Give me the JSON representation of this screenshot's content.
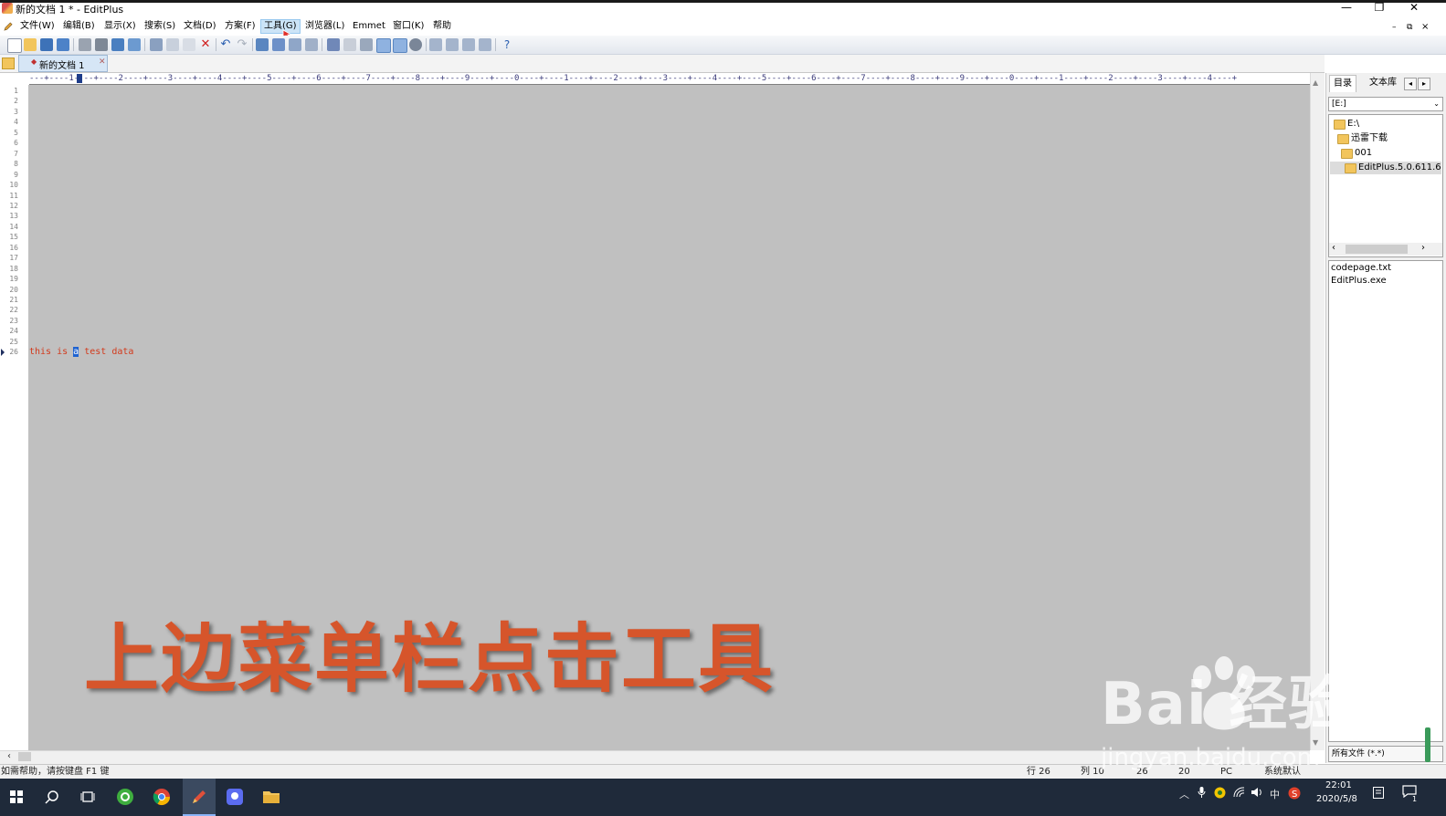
{
  "window": {
    "title": "新的文档 1 * - EditPlus",
    "minimize": "—",
    "restore": "❐",
    "close": "✕",
    "doc_min": "–",
    "doc_restore": "⧉",
    "doc_close": "×"
  },
  "menu": {
    "items": [
      {
        "label": "文件(W)"
      },
      {
        "label": "编辑(B)"
      },
      {
        "label": "显示(X)"
      },
      {
        "label": "搜索(S)"
      },
      {
        "label": "文档(D)"
      },
      {
        "label": "方案(F)"
      },
      {
        "label": "工具(G)",
        "active": true
      },
      {
        "label": "浏览器(L)"
      },
      {
        "label": "Emmet"
      },
      {
        "label": "窗口(K)"
      },
      {
        "label": "帮助"
      }
    ]
  },
  "tab": {
    "label": "新的文档 1",
    "modified_marker": "◆",
    "close": "✕"
  },
  "ruler": "---+----1----+----2----+----3----+----4----+----5----+----6----+----7----+----8----+----9----+----0----+----1----+----2----+----3----+----4----+----5----+----6----+----7----+----8----+----9----+----0----+----1----+----2----+----3----+----4----+",
  "editor": {
    "line_numbers": [
      "1",
      "2",
      "3",
      "4",
      "5",
      "6",
      "7",
      "8",
      "9",
      "10",
      "11",
      "12",
      "13",
      "14",
      "15",
      "16",
      "17",
      "18",
      "19",
      "20",
      "21",
      "22",
      "23",
      "24",
      "25",
      "26"
    ],
    "code_before": "this is ",
    "code_selected": "a",
    "code_after": " test data",
    "caption": "上边菜单栏点击工具"
  },
  "right_panel": {
    "tab_directory": "目录",
    "tab_library": "文本库",
    "drive": "[E:]",
    "tree": [
      {
        "label": "E:\\"
      },
      {
        "label": "迅雷下载"
      },
      {
        "label": "001"
      },
      {
        "label": "EditPlus.5.0.611.6"
      }
    ],
    "files": [
      "codepage.txt",
      "EditPlus.exe"
    ],
    "filter": "所有文件 (*.*)"
  },
  "status": {
    "help": "如需帮助，请按键盘 F1 键",
    "line": "行 26",
    "col": "列 10",
    "v1": "26",
    "v2": "20",
    "mode": "PC",
    "encoding": "系统默认"
  },
  "taskbar": {
    "time": "22:01",
    "date": "2020/5/8",
    "ime": "中",
    "notify_count": "1"
  },
  "watermark": {
    "logo": "Bai  经验",
    "url": "jingyan.baidu.com"
  },
  "colors": {
    "editor_bg": "#c0c0c0",
    "code_text": "#d23a1c",
    "caption": "#d6552b",
    "taskbar": "#1f2a3a"
  }
}
